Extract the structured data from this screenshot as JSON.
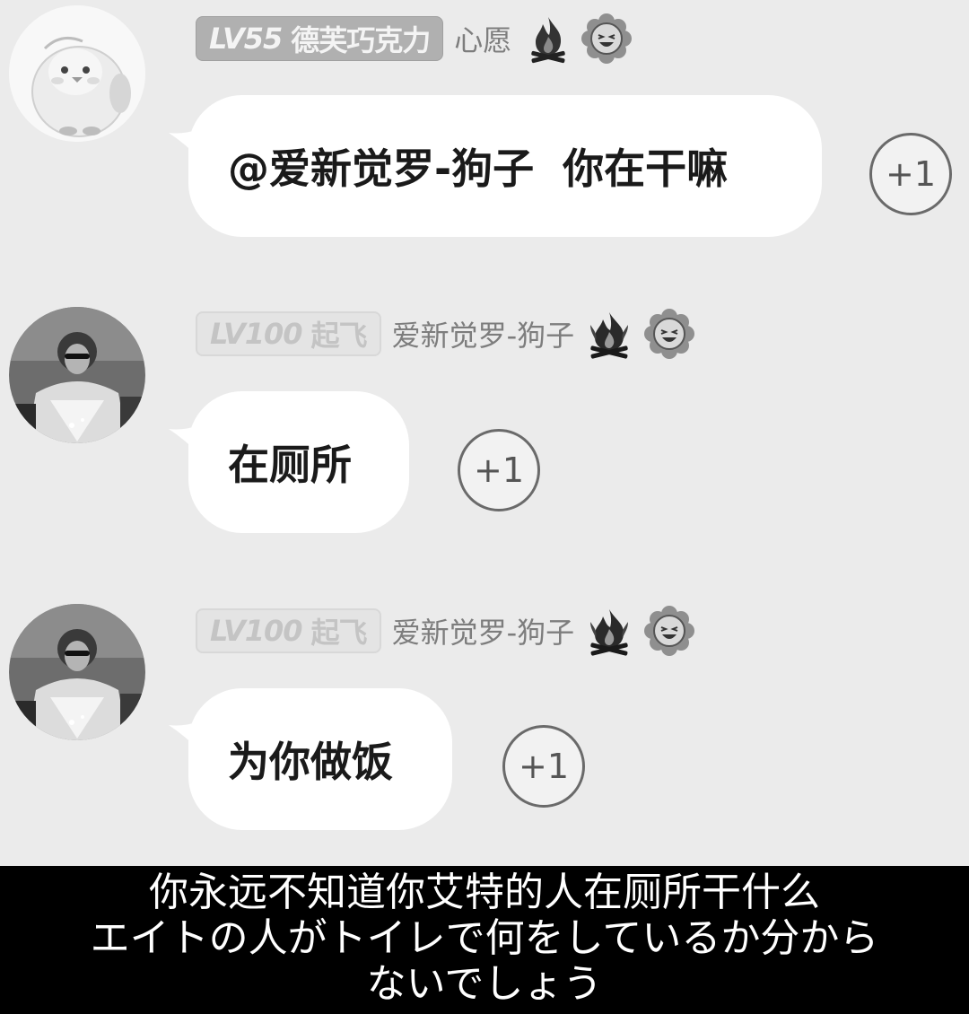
{
  "messages": [
    {
      "level_label": "LV55",
      "badge_text": "德芙巧克力",
      "username": "心愿",
      "icons": [
        "campfire-icon",
        "smiling-flower-icon"
      ],
      "text": "@爱新觉罗-狗子  你在干嘛",
      "plus_label": "+1"
    },
    {
      "level_label": "LV100",
      "badge_text": "起飞",
      "username": "爱新觉罗-狗子",
      "icons": [
        "campfire-icon",
        "smiling-flower-icon"
      ],
      "text": "在厕所",
      "plus_label": "+1"
    },
    {
      "level_label": "LV100",
      "badge_text": "起飞",
      "username": "爱新觉罗-狗子",
      "icons": [
        "campfire-icon",
        "smiling-flower-icon"
      ],
      "text": "为你做饭",
      "plus_label": "+1"
    }
  ],
  "caption": {
    "line1": "你永远不知道你艾特的人在厕所干什么",
    "line2": "エイトの人がトイレで何をしているか分から",
    "line3": "ないでしょう"
  }
}
